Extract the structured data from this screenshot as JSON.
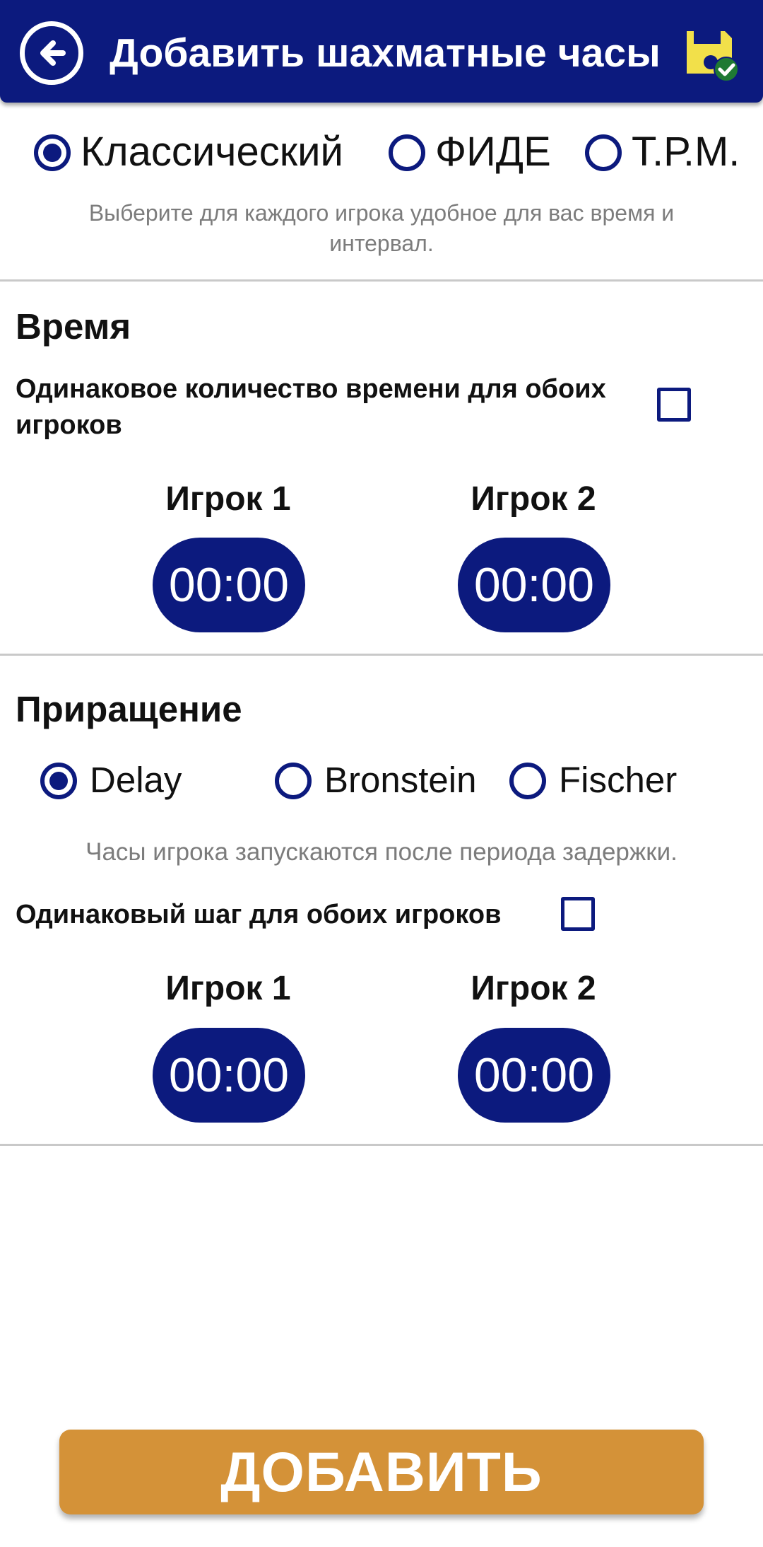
{
  "appbar": {
    "title": "Добавить шахматные часы",
    "back_icon": "arrow-left-circle-icon",
    "save_icon": "save-check-icon",
    "bg_color": "#0c1a7e",
    "save_icon_color": "#f2e04a",
    "check_color": "#1f7a33"
  },
  "clock_type": {
    "options": [
      {
        "label": "Классический",
        "selected": true
      },
      {
        "label": "ФИДЕ",
        "selected": false
      },
      {
        "label": "Т.Р.М.",
        "selected": false
      }
    ],
    "hint": "Выберите для каждого игрока удобное для вас время и интервал."
  },
  "time": {
    "title": "Время",
    "same_label": "Одинаковое количество времени для обоих игроков",
    "same_checked": false,
    "player1_label": "Игрок 1",
    "player2_label": "Игрок 2",
    "player1_value": "00:00",
    "player2_value": "00:00"
  },
  "increment": {
    "title": "Приращение",
    "options": [
      {
        "label": "Delay",
        "selected": true
      },
      {
        "label": "Bronstein",
        "selected": false
      },
      {
        "label": "Fischer",
        "selected": false
      }
    ],
    "hint": "Часы игрока запускаются после периода задержки.",
    "same_label": "Одинаковый шаг для обоих игроков",
    "same_checked": false,
    "player1_label": "Игрок 1",
    "player2_label": "Игрок 2",
    "player1_value": "00:00",
    "player2_value": "00:00"
  },
  "add_button": {
    "label": "ДОБАВИТЬ",
    "color": "#d49238"
  }
}
